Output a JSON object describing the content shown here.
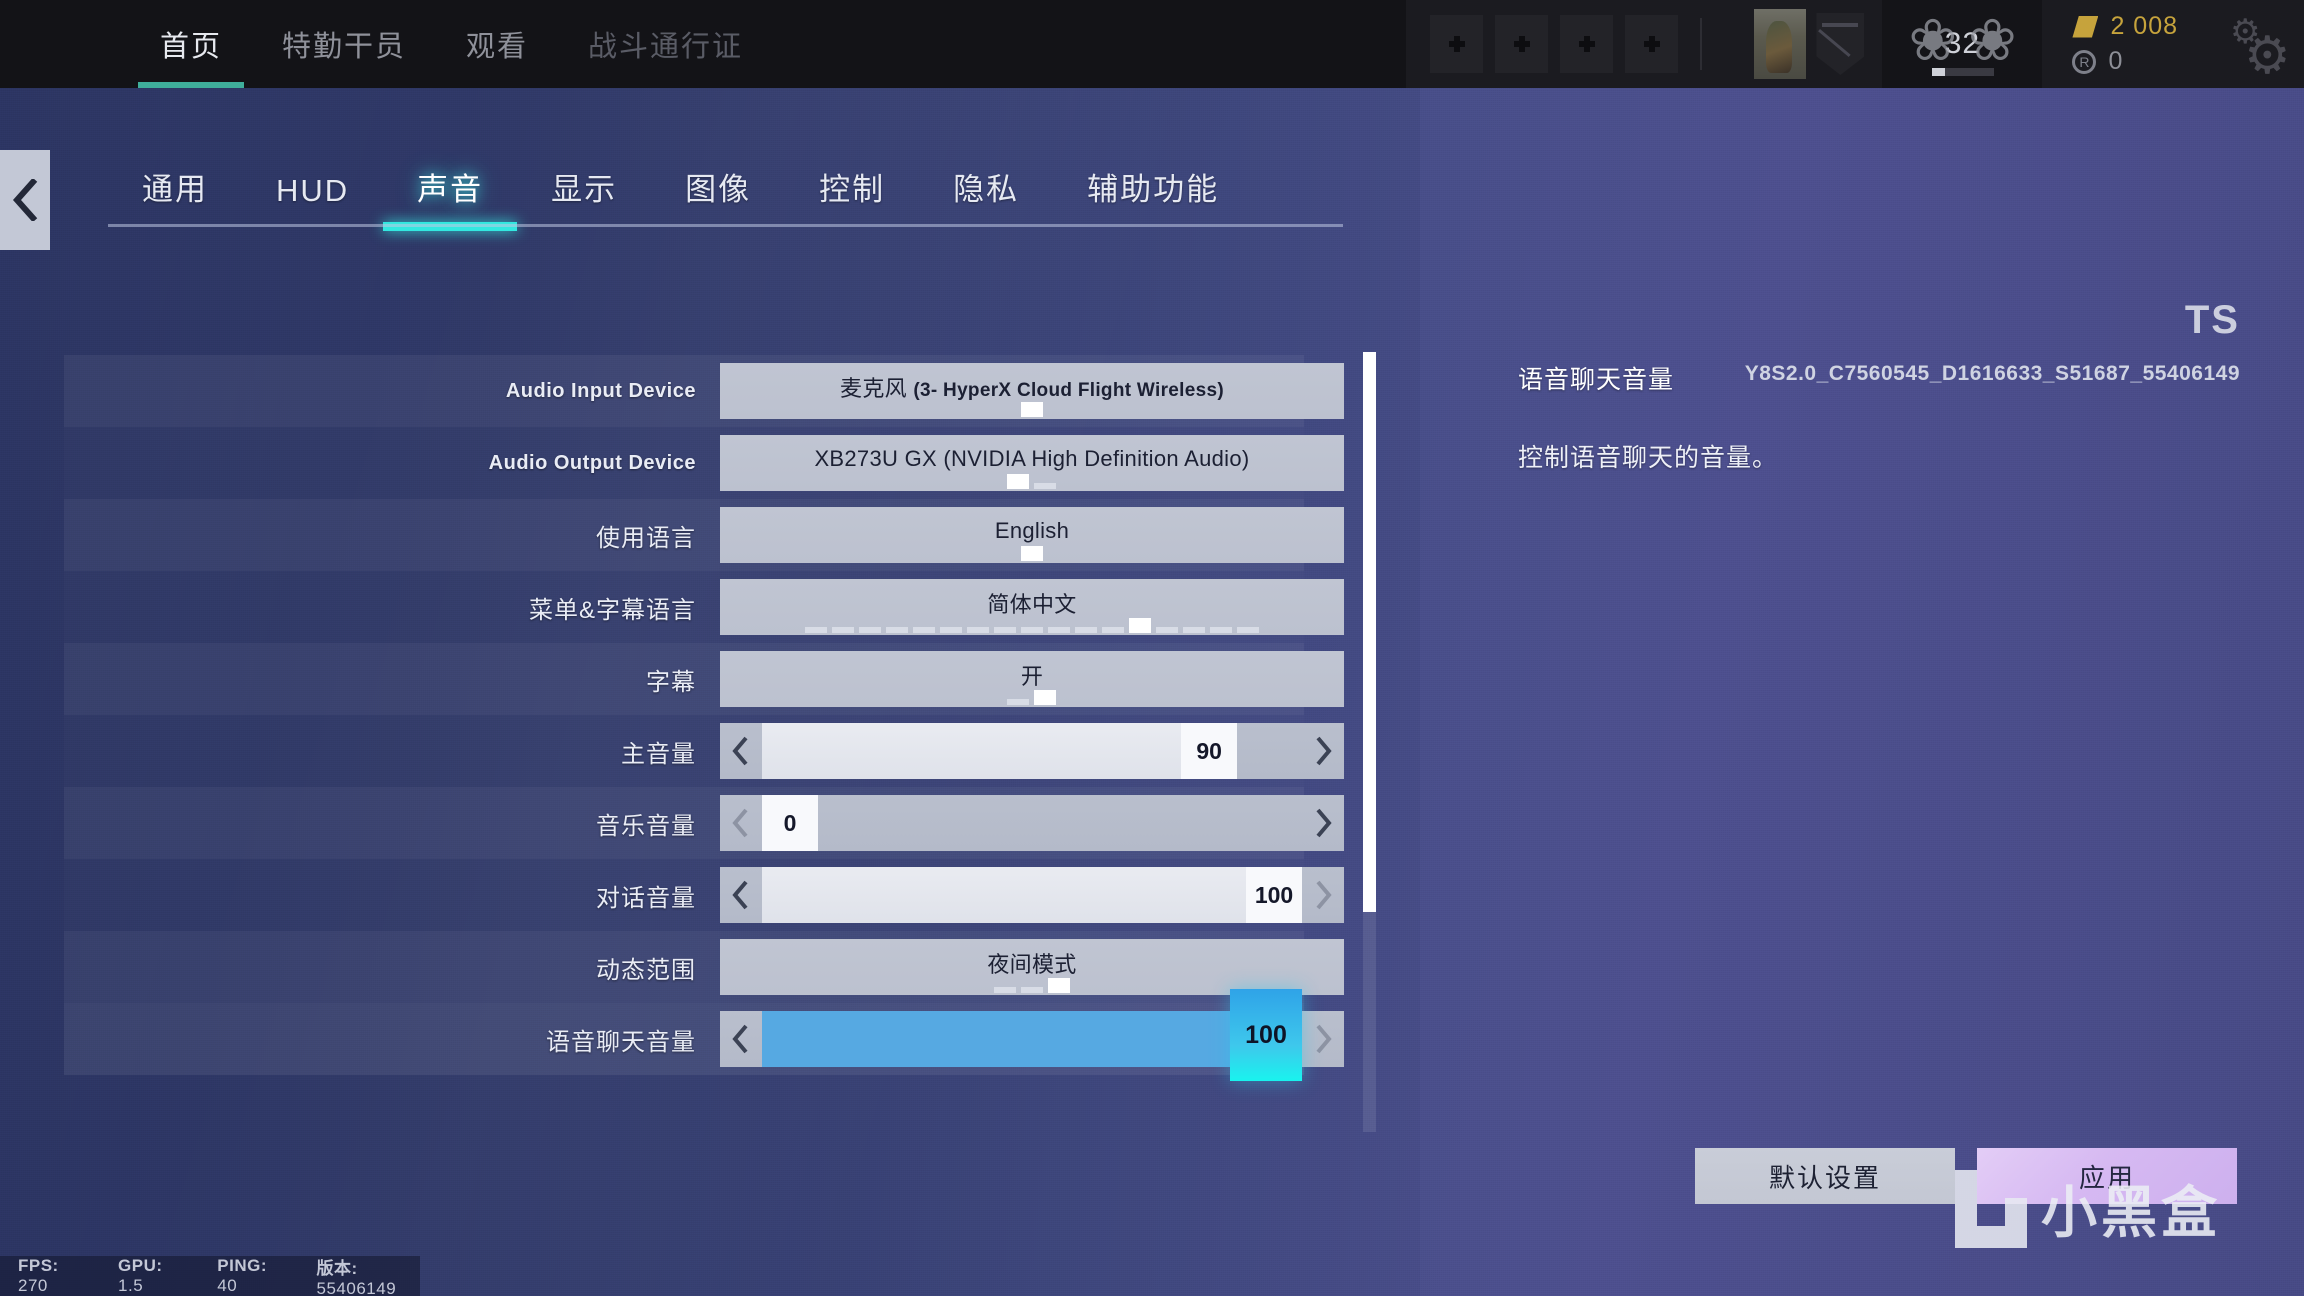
{
  "topnav": {
    "items": [
      {
        "label": "首页",
        "state": "active"
      },
      {
        "label": "特勤干员",
        "state": "normal"
      },
      {
        "label": "观看",
        "state": "normal"
      },
      {
        "label": "战斗通行证",
        "state": "dim"
      }
    ],
    "rank_level": "32",
    "currency": {
      "renown": "2 008",
      "credits": "0"
    },
    "gear_icon": "gear-icon",
    "avatar_icon": "operator-avatar",
    "badge_icon": "clan-badge-icon"
  },
  "back_button": {
    "icon": "chevron-left-icon"
  },
  "tabs": [
    {
      "label": "通用",
      "active": false
    },
    {
      "label": "HUD",
      "active": false
    },
    {
      "label": "声音",
      "active": true
    },
    {
      "label": "显示",
      "active": false
    },
    {
      "label": "图像",
      "active": false
    },
    {
      "label": "控制",
      "active": false
    },
    {
      "label": "隐私",
      "active": false
    },
    {
      "label": "辅助功能",
      "active": false
    }
  ],
  "settings": [
    {
      "label": "Audio Input Device",
      "label_lang": "en",
      "type": "dropdown",
      "value": "麦克风 (3- HyperX Cloud Flight Wireless)",
      "value_cn": "麦克风",
      "value_en": "(3- HyperX Cloud Flight Wireless)",
      "pips_total": 1,
      "pips_index": 0
    },
    {
      "label": "Audio Output Device",
      "label_lang": "en",
      "type": "dropdown",
      "value": "XB273U GX (NVIDIA High Definition Audio)",
      "pips_total": 2,
      "pips_index": 0
    },
    {
      "label": "使用语言",
      "label_lang": "cn",
      "type": "dropdown",
      "value": "English",
      "pips_total": 1,
      "pips_index": 0
    },
    {
      "label": "菜单&字幕语言",
      "label_lang": "cn",
      "type": "dropdown",
      "value": "简体中文",
      "pips_total": 17,
      "pips_index": 12
    },
    {
      "label": "字幕",
      "label_lang": "cn",
      "type": "dropdown",
      "value": "开",
      "pips_total": 2,
      "pips_index": 1
    },
    {
      "label": "主音量",
      "label_lang": "cn",
      "type": "slider",
      "value": "90",
      "percent": 88,
      "selected": false
    },
    {
      "label": "音乐音量",
      "label_lang": "cn",
      "type": "slider",
      "value": "0",
      "percent": 0,
      "selected": false
    },
    {
      "label": "对话音量",
      "label_lang": "cn",
      "type": "slider",
      "value": "100",
      "percent": 100,
      "selected": false
    },
    {
      "label": "动态范围",
      "label_lang": "cn",
      "type": "dropdown",
      "value": "夜间模式",
      "pips_total": 3,
      "pips_index": 2
    },
    {
      "label": "语音聊天音量",
      "label_lang": "cn",
      "type": "slider",
      "value": "100",
      "percent": 100,
      "selected": true
    }
  ],
  "detail": {
    "title": "语音聊天音量",
    "description": "控制语音聊天的音量。",
    "ts_label": "TS",
    "version_string": "Y8S2.0_C7560545_D1616633_S51687_55406149"
  },
  "buttons": {
    "reset": "默认设置",
    "apply": "应用"
  },
  "watermark": {
    "text": "小黑盒"
  },
  "status": {
    "fps_label": "FPS:",
    "fps_value": "270",
    "gpu_label": "GPU:",
    "gpu_value": "1.5",
    "ping_label": "PING:",
    "ping_value": "40",
    "version_label": "版本:",
    "version_value": "55406149"
  },
  "colors": {
    "accent_cyan": "#33e8e0",
    "nav_active": "#3fae9b",
    "slider_blue": "#56a9e2",
    "apply_purple": "#d6b9f2",
    "renown_gold": "#c6a33c"
  }
}
